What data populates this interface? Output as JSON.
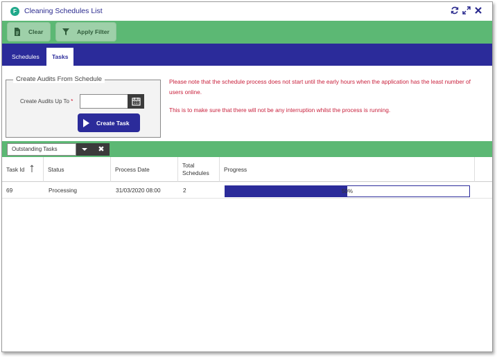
{
  "window": {
    "title": "Cleaning Schedules List",
    "app_icon_letter": "F"
  },
  "toolbar": {
    "clear_label": "Clear",
    "filter_label": "Apply Filter"
  },
  "tabs": [
    {
      "label": "Schedules",
      "active": false
    },
    {
      "label": "Tasks",
      "active": true
    }
  ],
  "audits": {
    "legend": "Create Audits From Schedule",
    "field_label": "Create Audits Up To",
    "required_mark": "*",
    "date_value": "",
    "create_label": "Create Task"
  },
  "notices": {
    "line1": "Please note that the schedule process does not start until the early hours when the application has the least number of users online.",
    "line2": "This is to make sure that there will not be any interruption whilst the process is running."
  },
  "filter": {
    "selected": "Outstanding Tasks"
  },
  "grid": {
    "headers": {
      "task_id": "Task Id",
      "status": "Status",
      "process_date": "Process Date",
      "total_schedules": "Total Schedules",
      "progress": "Progress"
    },
    "rows": [
      {
        "task_id": "69",
        "status": "Processing",
        "process_date": "31/03/2020 08:00",
        "total_schedules": "2",
        "progress_text": "50%",
        "progress": 0.5
      }
    ]
  },
  "colors": {
    "accent_blue": "#2b2b9a",
    "toolbar_green": "#5cb874",
    "notice_red": "#c81e3a"
  }
}
